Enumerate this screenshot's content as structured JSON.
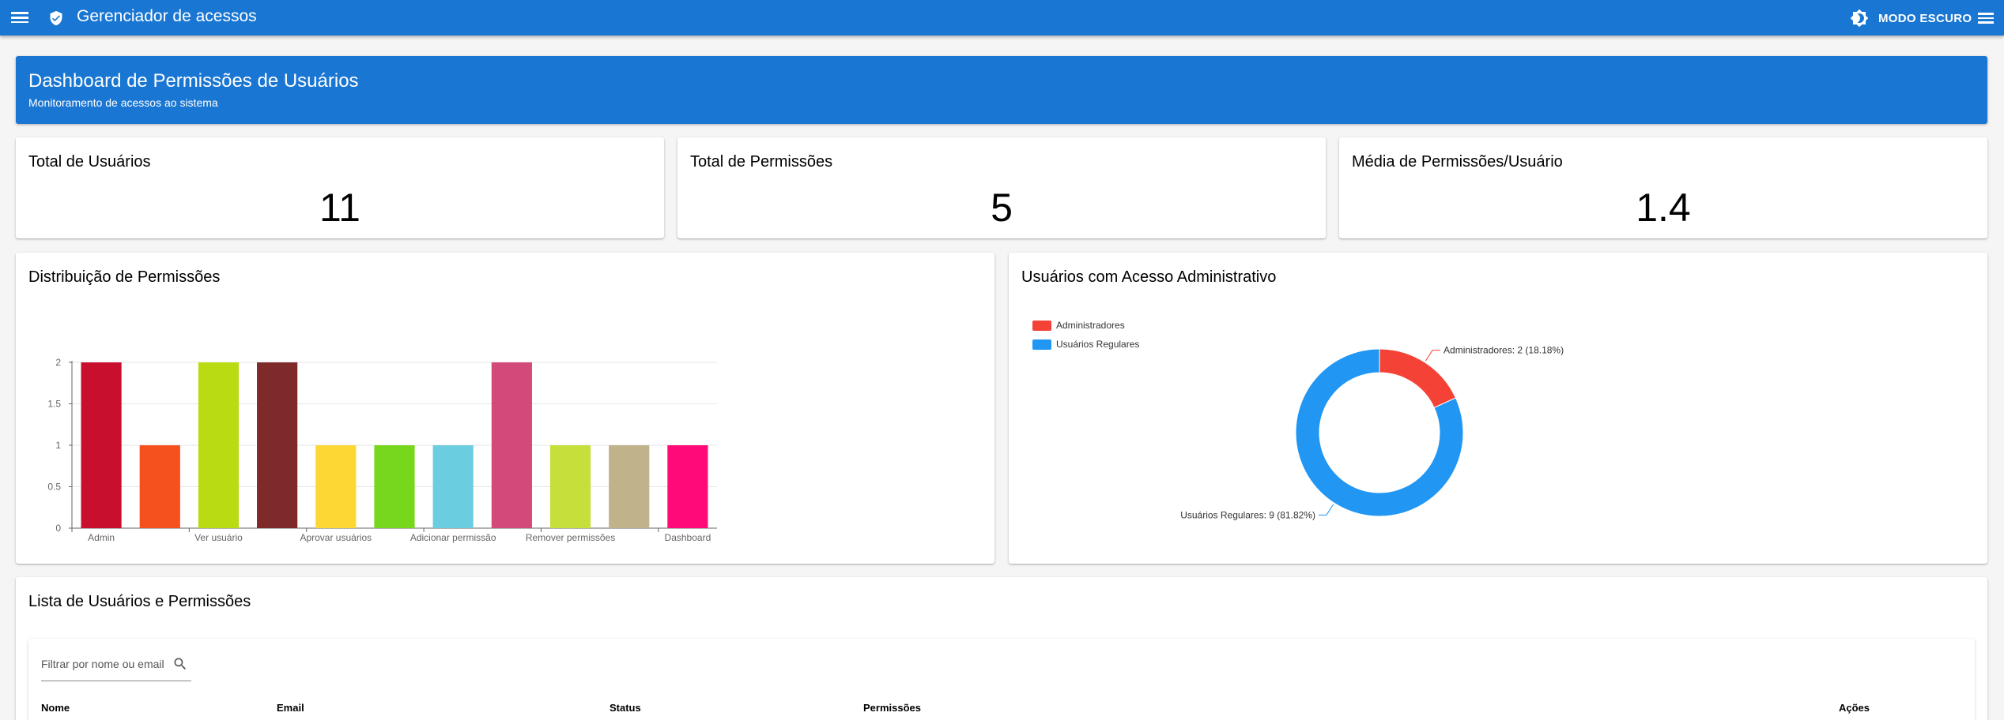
{
  "appbar": {
    "title": "Gerenciador de acessos",
    "theme_label": "MODO ESCURO"
  },
  "banner": {
    "title": "Dashboard de Permissões de Usuários",
    "subtitle": "Monitoramento de acessos ao sistema"
  },
  "stats": [
    {
      "label": "Total de Usuários",
      "value": "11"
    },
    {
      "label": "Total de Permissões",
      "value": "5"
    },
    {
      "label": "Média de Permissões/Usuário",
      "value": "1.4"
    }
  ],
  "bar_card": {
    "title": "Distribuição de Permissões"
  },
  "pie_card": {
    "title": "Usuários com Acesso Administrativo"
  },
  "list_card": {
    "title": "Lista de Usuários e Permissões",
    "filter_placeholder": "Filtrar por nome ou email",
    "columns": [
      "Nome",
      "Email",
      "Status",
      "Permissões",
      "Ações"
    ]
  },
  "chart_data": [
    {
      "type": "bar",
      "title": "",
      "x_tick_labels": [
        "Admin",
        "Ver usuário",
        "Aprovar usuários",
        "Adicionar permissão",
        "Remover permissões",
        "Dashboard"
      ],
      "values": [
        2,
        1,
        2,
        2,
        1,
        1,
        1,
        2,
        1,
        1,
        1
      ],
      "colors": [
        "#c8102e",
        "#f4511e",
        "#b9db12",
        "#7e2a2a",
        "#fdd835",
        "#76d71c",
        "#6acee0",
        "#d34a7a",
        "#c7df3a",
        "#c0b38c",
        "#ff0a78"
      ],
      "ylim": [
        0,
        2
      ],
      "y_ticks": [
        "0",
        "0.5",
        "1",
        "1.5",
        "2"
      ],
      "grid": true
    },
    {
      "type": "pie",
      "donut": true,
      "legend": [
        "Administradores",
        "Usuários Regulares"
      ],
      "values": [
        2,
        9
      ],
      "labels": [
        "Administradores: 2 (18.18%)",
        "Usuários Regulares: 9 (81.82%)"
      ],
      "colors": [
        "#f44336",
        "#2196f3"
      ],
      "legend_position": "top-left"
    }
  ]
}
